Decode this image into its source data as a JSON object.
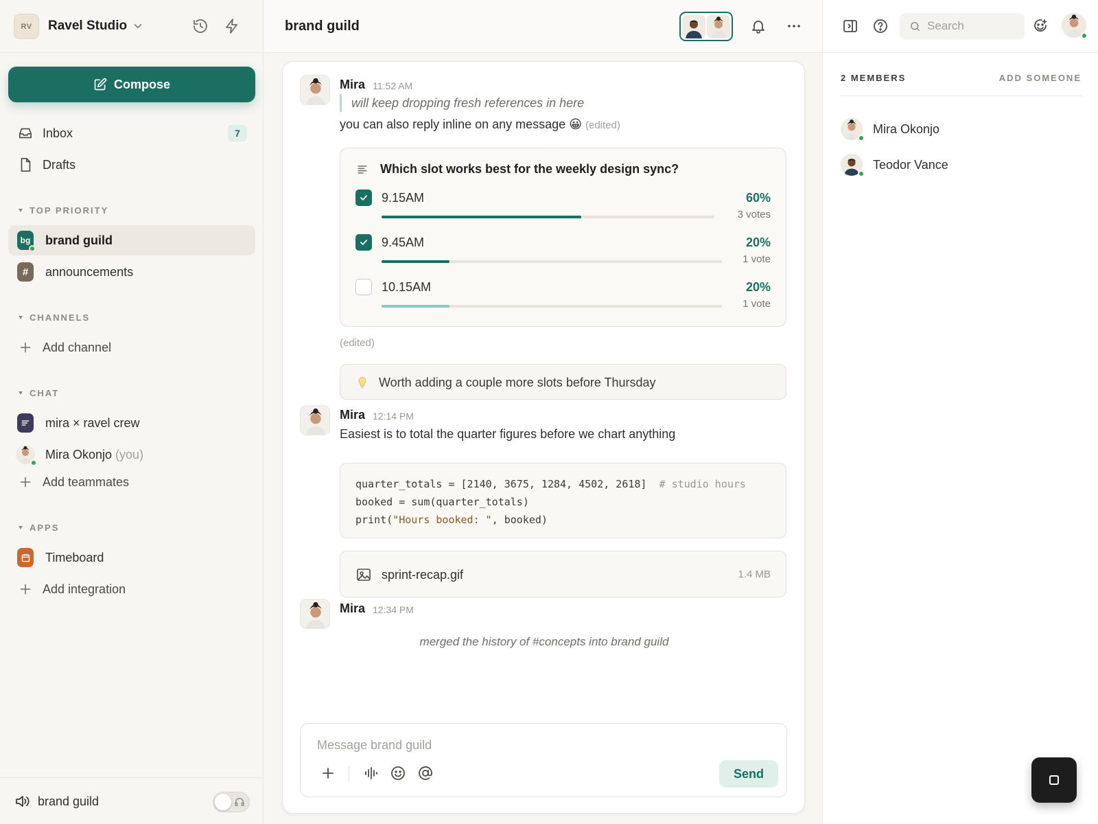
{
  "workspace": {
    "initials": "RV",
    "name": "Ravel Studio"
  },
  "sidebar": {
    "compose_label": "Compose",
    "nav": [
      {
        "label": "Inbox",
        "badge": "7"
      },
      {
        "label": "Drafts"
      }
    ],
    "sections": {
      "top_priority": "TOP PRIORITY",
      "channels": "CHANNELS",
      "chat": "CHAT",
      "apps": "APPS"
    },
    "top_priority_items": [
      {
        "label": "brand guild",
        "icon_text": "bg",
        "color": "#1a6e62",
        "active": true
      },
      {
        "label": "announcements",
        "icon_text": "#",
        "color": "#7a6a5a"
      }
    ],
    "add_channel": "Add channel",
    "chat_items": [
      {
        "label": "mira × ravel crew",
        "color": "#3d3a5c"
      },
      {
        "label": "Mira Okonjo",
        "suffix": "(you)"
      }
    ],
    "add_teammates": "Add teammates",
    "apps_items": [
      {
        "label": "Timeboard",
        "color": "#c66a2f"
      }
    ],
    "add_integration": "Add integration",
    "footer_label": "brand guild"
  },
  "main": {
    "title": "brand guild",
    "messages": [
      {
        "author": "Mira",
        "time": "11:52 AM",
        "quote": "will keep dropping fresh references in here",
        "text": "you can also reply inline on any message",
        "emoji": "😀",
        "edited": "(edited)"
      },
      {
        "author": "Mira",
        "time": "12:14 PM",
        "text": "Easiest is to total the quarter figures before we chart anything"
      },
      {
        "author": "Mira",
        "time": "12:34 PM"
      }
    ],
    "poll": {
      "question": "Which slot works best for the weekly design sync?",
      "options": [
        {
          "label": "9.15AM",
          "pct": "60%",
          "votes": "3 votes",
          "fraction": 0.6,
          "checked": true
        },
        {
          "label": "9.45AM",
          "pct": "20%",
          "votes": "1 vote",
          "fraction": 0.2,
          "checked": true
        },
        {
          "label": "10.15AM",
          "pct": "20%",
          "votes": "1 vote",
          "fraction": 0.2,
          "checked": false
        }
      ],
      "edited": "(edited)"
    },
    "tip": "Worth adding a couple more slots before Thursday",
    "code": {
      "line1_code": "quarter_totals = [2140, 3675, 1284, 4502, 2618]",
      "line1_comment": "# studio hours",
      "line2": "booked = sum(quarter_totals)",
      "line3_pre": "print(",
      "line3_str": "\"Hours booked: \"",
      "line3_post": ", booked)"
    },
    "file": {
      "name": "sprint-recap.gif",
      "size": "1.4 MB"
    },
    "system_message": "merged the history of #concepts into brand guild",
    "composer": {
      "placeholder": "Message brand guild",
      "send_label": "Send"
    }
  },
  "right_panel": {
    "search_placeholder": "Search",
    "members_title": "2 MEMBERS",
    "add_someone": "ADD SOMEONE",
    "members": [
      {
        "name": "Mira Okonjo"
      },
      {
        "name": "Teodor Vance"
      }
    ]
  },
  "colors": {
    "accent": "#1a6e62",
    "accent_light": "#e1efeb",
    "online": "#2fa65a"
  }
}
